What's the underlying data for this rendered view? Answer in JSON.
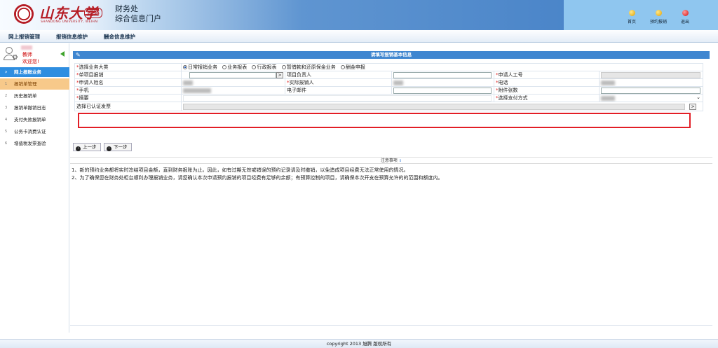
{
  "header": {
    "logo_text": "山东大学",
    "logo_campus": "威海",
    "logo_sub": "SHANDONG UNIVERSITY, WEIHAI",
    "title_line1": "财务处",
    "title_line2": "综合信息门户",
    "nav": [
      {
        "label": "首页",
        "icon": "home-dot-icon",
        "color": "#e2a100"
      },
      {
        "label": "预约报销",
        "icon": "reserve-dot-icon",
        "color": "#e2a100"
      },
      {
        "label": "退出",
        "icon": "logout-dot-icon",
        "color": "#d31010"
      }
    ]
  },
  "menubar": {
    "items": [
      "网上报销管理",
      "报销信息维护",
      "酬金信息维护"
    ]
  },
  "sidebar": {
    "role": "教师",
    "welcome": "欢迎您!",
    "section": "网上报账业务",
    "items": [
      {
        "num": "1",
        "label": "报销单管理"
      },
      {
        "num": "2",
        "label": "历史报销单"
      },
      {
        "num": "3",
        "label": "报销单撤销日志"
      },
      {
        "num": "4",
        "label": "支付失败报销单"
      },
      {
        "num": "5",
        "label": "公务卡消费认证"
      },
      {
        "num": "6",
        "label": "增值税发票查验"
      }
    ]
  },
  "main": {
    "title": "请填写报销基本信息",
    "form": {
      "business_type_label": "选择业务大类",
      "business_types": [
        "日常报销业务",
        "业务报表",
        "行政报表",
        "暂借款和还原保金业务",
        "酬金申报"
      ],
      "single_project_label": "单项目报销",
      "project_leader_label": "项目负责人",
      "applicant_id_label": "申请人工号",
      "applicant_name_label": "申请人姓名",
      "actual_reimburser_label": "实际报销人",
      "phone_label": "电话",
      "mobile_label": "手机",
      "email_label": "电子邮件",
      "attachments_label": "附件张数",
      "summary_label": "摘要",
      "payment_method_label": "选择支付方式",
      "invoice_label": "选择已认证发票",
      "picker_button": ">"
    },
    "buttons": {
      "prev": "上一步",
      "next": "下一步"
    },
    "notes_title": "注意事项",
    "notes_toggle": "⇕",
    "notes": [
      "1、新的预约业务都将实时冻结项目金额，直到财务报账为止。因此，如有过期无效或错误的预约记录请及时撤销，以免造成项目经费无法正常使用的情况。",
      "2、为了确保您在财务处柜台顺利办理报销业务，请您确认本次申请预约报销的项目经费有足够的余额；有预算控制的项目，请确保本次开支在预算允许的的范围和额度内。"
    ]
  },
  "footer": {
    "copyright": "copyright 2013 旭腾 版权所有"
  },
  "colors": {
    "accent": "#3f86d0",
    "required": "#e02020",
    "highlight": "#e21e26",
    "active_item": "#f7c98a"
  }
}
